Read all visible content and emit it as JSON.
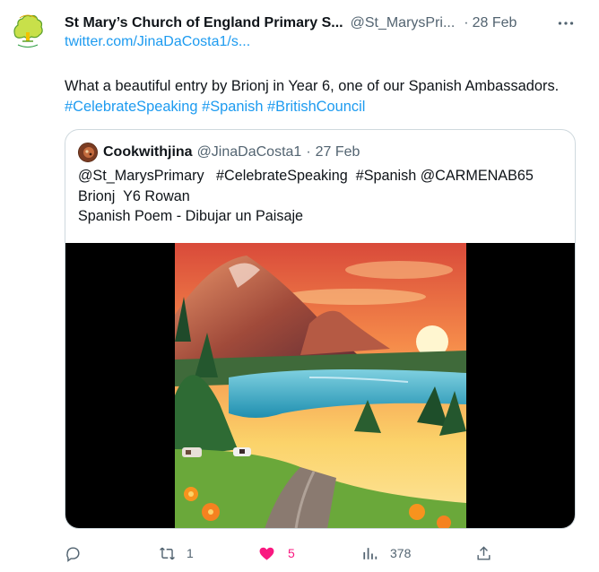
{
  "tweet": {
    "display_name": "St Mary’s Church of England Primary S...",
    "handle": "@St_MarysPri...",
    "separator": "·",
    "date": "28 Feb",
    "link_text": "twitter.com/JinaDaCosta1/s...",
    "text_plain": "What a beautiful entry by Brionj in Year 6, one of our Spanish Ambassadors.",
    "hashtags": [
      "#CelebrateSpeaking",
      "#Spanish",
      "#BritishCouncil"
    ],
    "avatar_icon": "school-tree-logo-icon",
    "more_icon": "more-horizontal-icon"
  },
  "quoted": {
    "display_name": "Cookwithjina",
    "handle": "@JinaDaCosta1",
    "separator": "·",
    "date": "27 Feb",
    "lines": [
      "@St_MarysPrimary   #CelebrateSpeaking  #Spanish @CARMENAB65",
      "Brionj  Y6 Rowan",
      "Spanish Poem - Dibujar un Paisaje"
    ],
    "media_icon": "landscape-painting-image"
  },
  "actions": {
    "reply": {
      "icon": "reply-icon",
      "count": ""
    },
    "retweet": {
      "icon": "retweet-icon",
      "count": "1"
    },
    "like": {
      "icon": "heart-icon",
      "count": "5",
      "color": "#f91880"
    },
    "views": {
      "icon": "views-chart-icon",
      "count": "378"
    },
    "share": {
      "icon": "share-icon",
      "count": ""
    }
  },
  "colors": {
    "link": "#1d9bf0",
    "secondary_text": "#536471",
    "primary_text": "#0f1419",
    "border": "#cfd9de",
    "like": "#f91880"
  }
}
